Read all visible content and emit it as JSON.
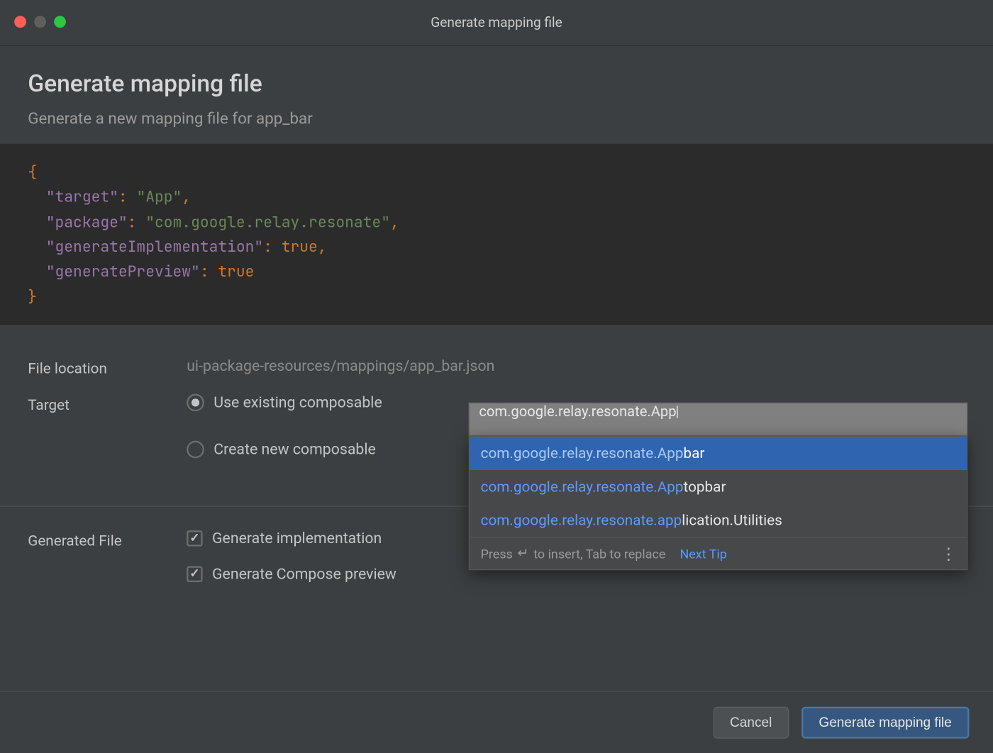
{
  "window": {
    "title": "Generate mapping file"
  },
  "header": {
    "title": "Generate mapping file",
    "subtitle": "Generate a new mapping file for app_bar"
  },
  "code": {
    "lines": [
      {
        "type": "brace",
        "text": "{"
      },
      {
        "type": "kv-str",
        "key": "\"target\"",
        "value": "\"App\"",
        "trailing": ","
      },
      {
        "type": "kv-str",
        "key": "\"package\"",
        "value": "\"com.google.relay.resonate\"",
        "trailing": ","
      },
      {
        "type": "kv-bool",
        "key": "\"generateImplementation\"",
        "value": "true",
        "trailing": ","
      },
      {
        "type": "kv-bool",
        "key": "\"generatePreview\"",
        "value": "true",
        "trailing": ""
      },
      {
        "type": "brace",
        "text": "}"
      }
    ]
  },
  "form": {
    "file_location_label": "File location",
    "file_location_value": "ui-package-resources/mappings/app_bar.json",
    "target_label": "Target",
    "target_options": {
      "use_existing": "Use existing composable",
      "create_new": "Create new composable"
    },
    "target_selected": "use_existing",
    "target_input_value": "com.google.relay.resonate.App",
    "generated_file_label": "Generated File",
    "checkboxes": {
      "gen_impl": {
        "label": "Generate implementation",
        "checked": true
      },
      "gen_preview": {
        "label": "Generate Compose preview",
        "checked": true
      }
    }
  },
  "autocomplete": {
    "items": [
      {
        "match": "com.google.relay.resonate.App",
        "rest": "bar",
        "selected": true
      },
      {
        "match": "com.google.relay.resonate.App",
        "rest": "topbar",
        "selected": false
      },
      {
        "match": "com.google.relay.resonate.app",
        "rest": "lication.Utilities",
        "selected": false
      }
    ],
    "footer_hint_pre": "Press ",
    "footer_hint_post": " to insert, Tab to replace",
    "next_tip": "Next Tip"
  },
  "buttons": {
    "cancel": "Cancel",
    "primary": "Generate mapping file"
  }
}
